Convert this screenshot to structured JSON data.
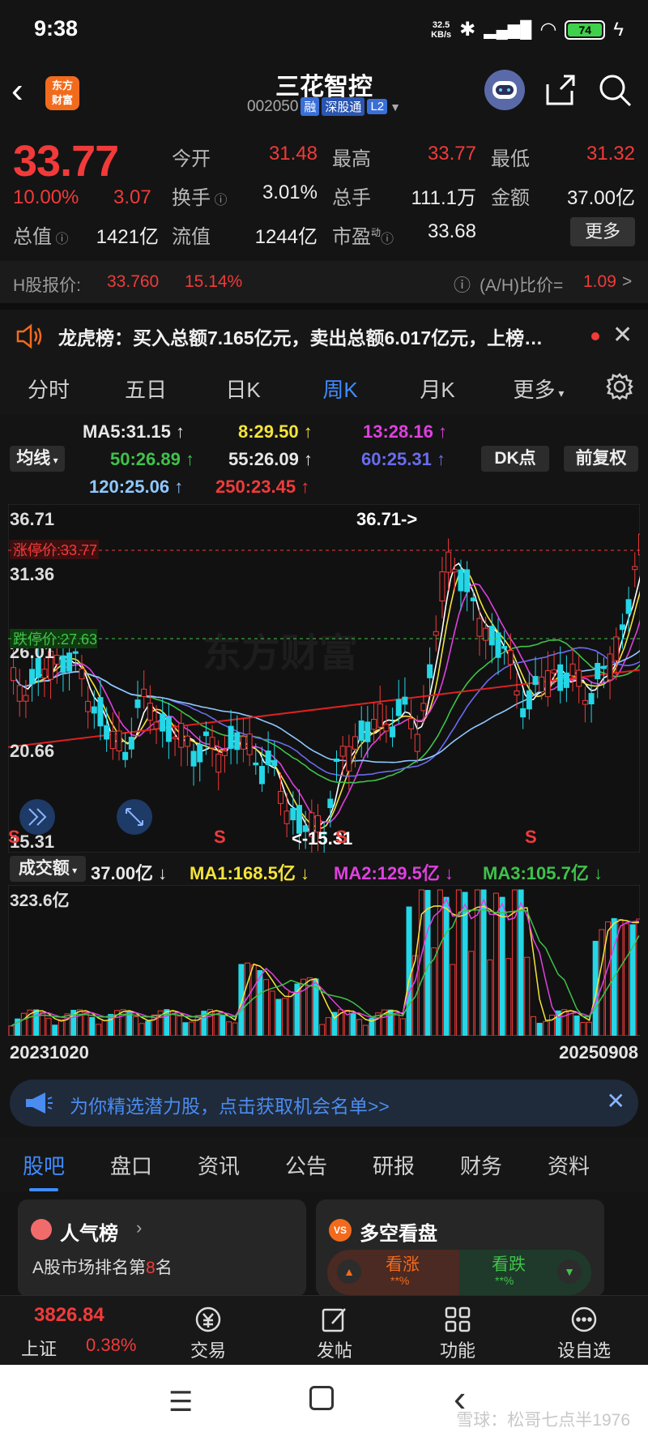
{
  "status": {
    "time": "9:38",
    "net_speed_top": "32.5",
    "net_speed_bottom": "KB/s",
    "battery": "74"
  },
  "header": {
    "logo_text_1": "东方",
    "logo_text_2": "财富",
    "stock_name": "三花智控",
    "stock_code": "002050",
    "tag_margin": "融",
    "tag_connect": "深股通",
    "tag_level": "L2"
  },
  "quote": {
    "price": "33.77",
    "change_pct": "10.00%",
    "change_abs": "3.07",
    "open_label": "今开",
    "open": "31.48",
    "high_label": "最高",
    "high": "33.77",
    "low_label": "最低",
    "low": "31.32",
    "turnover_label": "换手",
    "turnover": "3.01%",
    "volume_label": "总手",
    "volume": "111.1万",
    "amount_label": "金额",
    "amount": "37.00亿",
    "total_cap_label": "总值",
    "total_cap": "1421亿",
    "float_cap_label": "流值",
    "float_cap": "1244亿",
    "pe_label": "市盈",
    "pe_sup": "动",
    "pe": "33.68",
    "more_label": "更多"
  },
  "hshare": {
    "label": "H股报价:",
    "price": "33.760",
    "pct": "15.14%",
    "ah_label": "(A/H)比价=",
    "ah_value": "1.09",
    "arrow": ">"
  },
  "notice": {
    "text": "龙虎榜：买入总额7.165亿元，卖出总额6.017亿元，上榜…"
  },
  "period_tabs": [
    "分时",
    "五日",
    "日K",
    "周K",
    "月K",
    "更多"
  ],
  "period_active": "周K",
  "ma": {
    "ma5": "MA5:31.15 ↑",
    "ma8": "8:29.50 ↑",
    "ma13": "13:28.16 ↑",
    "ma50": "50:26.89 ↑",
    "ma55": "55:26.09 ↑",
    "ma60": "60:25.31 ↑",
    "ma120": "120:25.06 ↑",
    "ma250": "250:23.45 ↑",
    "indicator_btn": "均线",
    "dk_btn": "DK点",
    "adjust_btn": "前复权"
  },
  "chart_data": {
    "type": "candlestick",
    "y_ticks": [
      "36.71",
      "31.36",
      "26.01",
      "20.66",
      "15.31"
    ],
    "ylim": [
      15.31,
      36.71
    ],
    "high_marker": "36.71->",
    "low_marker": "<-15.31",
    "limit_up_label": "涨停价:33.77",
    "limit_down_label": "跌停价:27.63",
    "watermark": "东方财富",
    "signal_labels": [
      "S",
      "S",
      "S",
      "S"
    ],
    "x_start": "20231020",
    "x_end": "20250908",
    "volume": {
      "label": "成交额",
      "amount": "37.00亿 ↓",
      "ma1": "MA1:168.5亿 ↓",
      "ma2": "MA2:129.5亿 ↓",
      "ma3": "MA3:105.7亿 ↓",
      "y_max_label": "323.6亿"
    }
  },
  "ad": {
    "text": "为你精选潜力股，点击获取机会名单>>"
  },
  "info_tabs": [
    "股吧",
    "盘口",
    "资讯",
    "公告",
    "研报",
    "财务",
    "资料"
  ],
  "cards": {
    "left_title": "人气榜",
    "left_sub_prefix": "A股市场排名第",
    "left_rank": "8",
    "left_sub_suffix": "名",
    "right_title": "多空看盘",
    "bull": "看涨",
    "bear": "看跌",
    "bull_pct": "**%",
    "bear_pct": "**%"
  },
  "bottom_nav": {
    "index_value": "3826.84",
    "index_name": "上证",
    "index_pct": "0.38%",
    "trade": "交易",
    "post": "发帖",
    "func": "功能",
    "watch": "设自选"
  },
  "watermark": "雪球：松哥七点半1976"
}
